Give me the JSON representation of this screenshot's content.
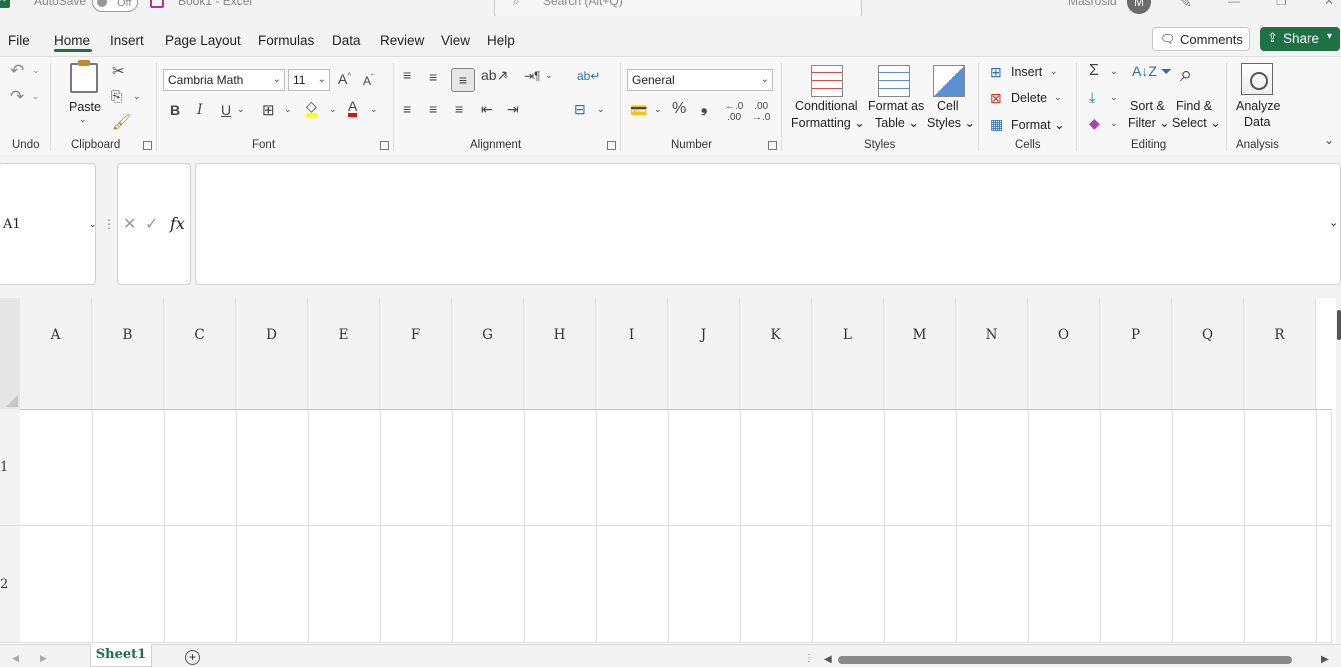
{
  "titlebar": {
    "autosave": "AutoSave",
    "toggle": "Off",
    "doc_title": "Book1  -  Excel",
    "search_placeholder": "Search (Alt+Q)",
    "user_name": "Masrosid",
    "avatar_initial": "M"
  },
  "menu": {
    "tabs": [
      "File",
      "Home",
      "Insert",
      "Page Layout",
      "Formulas",
      "Data",
      "Review",
      "View",
      "Help"
    ],
    "active": "Home",
    "comments": "Comments",
    "share": "Share"
  },
  "ribbon": {
    "groups": {
      "undo": "Undo",
      "clipboard": "Clipboard",
      "font": "Font",
      "alignment": "Alignment",
      "number": "Number",
      "styles": "Styles",
      "cells": "Cells",
      "editing": "Editing",
      "analysis": "Analysis"
    },
    "paste": "Paste",
    "font_name": "Cambria Math",
    "font_size": "11",
    "number_format": "General",
    "styles": {
      "conditional_1": "Conditional",
      "conditional_2": "Formatting",
      "format_table_1": "Format as",
      "format_table_2": "Table",
      "cell_styles_1": "Cell",
      "cell_styles_2": "Styles"
    },
    "cells": {
      "insert": "Insert",
      "delete": "Delete",
      "format": "Format"
    },
    "editing": {
      "sort_1": "Sort &",
      "sort_2": "Filter",
      "find_1": "Find &",
      "find_2": "Select"
    },
    "analysis": {
      "analyze_1": "Analyze",
      "analyze_2": "Data"
    },
    "accent": "#1e7145"
  },
  "formula_bar": {
    "name_box": "A1",
    "fx": "fx",
    "value": ""
  },
  "grid": {
    "columns": [
      "A",
      "B",
      "C",
      "D",
      "E",
      "F",
      "G",
      "H",
      "I",
      "J",
      "K",
      "L",
      "M",
      "N",
      "O",
      "P",
      "Q",
      "R"
    ],
    "rows": [
      "1",
      "2"
    ]
  },
  "sheets": {
    "tabs": [
      "Sheet1"
    ],
    "active": "Sheet1"
  }
}
